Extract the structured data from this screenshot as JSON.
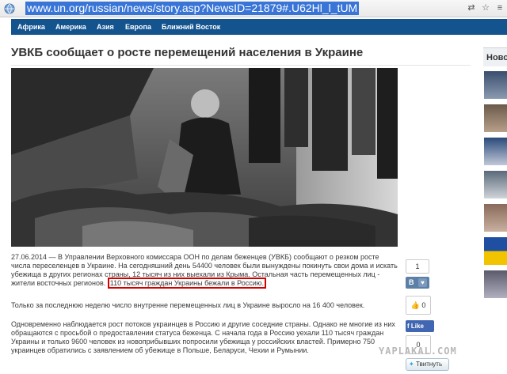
{
  "browser": {
    "url": "www.un.org/russian/news/story.asp?NewsID=21879#.U62Hl_l_tUM",
    "icons": [
      "globe-icon",
      "translate-icon",
      "star-icon",
      "menu-icon"
    ]
  },
  "nav": {
    "items": [
      "Африка",
      "Америка",
      "Азия",
      "Европа",
      "Ближний Восток"
    ]
  },
  "article": {
    "title": "УВКБ сообщает о росте перемещений населения в Украине",
    "p1_pre": "27.06.2014 — В Управлении Верховного комиссара ООН по делам беженцев (УВКБ) сообщают о резком росте числа переселенцев в Украине. На сегодняшний день 54400 человек были вынуждены покинуть свои дома и искать убежища в других регионах страны, 12 тысяч из них выехали из Крыма. Остальная часть перемещенных лиц - жители восточных регионов.",
    "p1_highlight": "110 тысяч граждан Украины бежали в Россию.",
    "p2": "Только за последнюю неделю число внутренне перемещенных лиц в Украине выросло на 16 400 человек.",
    "p3": "Одновременно наблюдается рост потоков украинцев в Россию и другие соседние страны. Однако не многие из них обращаются с просьбой о предоставлении статуса беженца. С начала года в Россию уехали 110 тысяч граждан Украины и только 9600 человек из новоприбывших попросили убежища у российских властей. Примерно 750 украинцев обратились с заявлением об убежище в Польше, Беларуси, Чехии и Румынии."
  },
  "share": {
    "count_top": "1",
    "vk_label": "В",
    "count_mid": "0",
    "fb_like": "Like",
    "count_bottom": "0",
    "tweet": "Твитнуть"
  },
  "sidebar": {
    "heading": "Ново"
  },
  "watermark": "YAPLAKAL.COM",
  "colors": {
    "nav": "#13538e",
    "highlight_border": "#d40000",
    "url_selection": "#3875d7"
  }
}
